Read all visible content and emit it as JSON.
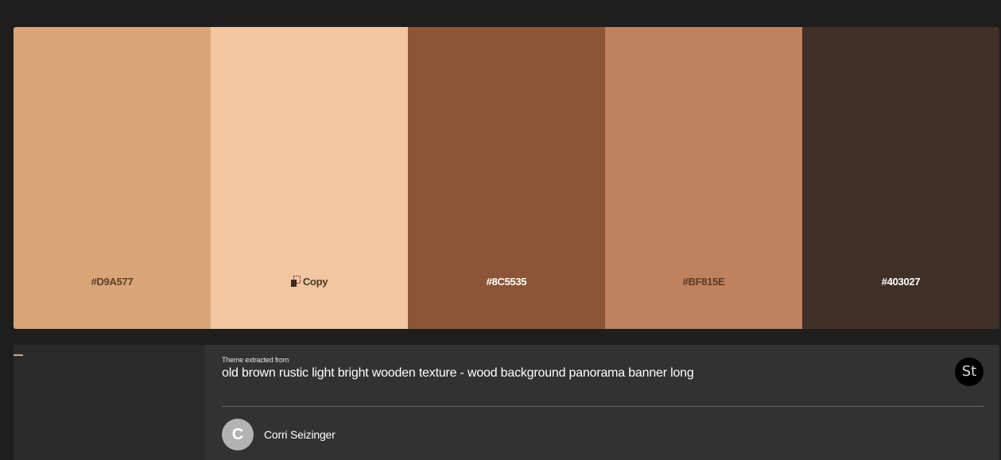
{
  "palette": {
    "swatches": [
      {
        "color": "#D9A577",
        "label": "#D9A577",
        "text_color": "#5a4030"
      },
      {
        "color": "#F2C6A0",
        "label": "Copy",
        "text_color": "#4a3628"
      },
      {
        "color": "#8C5535",
        "label": "#8C5535",
        "text_color": "#ffffff"
      },
      {
        "color": "#BF815E",
        "label": "#BF815E",
        "text_color": "#5a3a2a"
      },
      {
        "color": "#403027",
        "label": "#403027",
        "text_color": "#ffffff"
      }
    ]
  },
  "info": {
    "kicker": "Theme extracted from",
    "title": "old brown rustic light bright wooden texture - wood background panorama banner long",
    "stock_badge": "St",
    "author": {
      "initial": "C",
      "name": "Corri Seizinger"
    }
  }
}
